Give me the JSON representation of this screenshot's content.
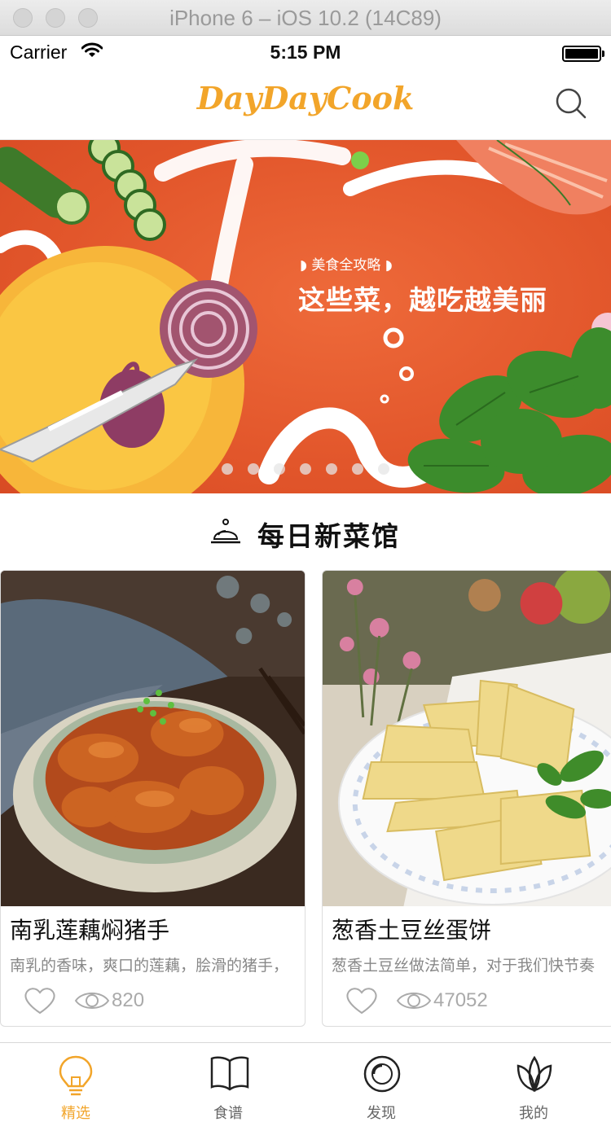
{
  "window": {
    "title": "iPhone 6 – iOS 10.2 (14C89)"
  },
  "status_bar": {
    "carrier": "Carrier",
    "time": "5:15 PM"
  },
  "navbar": {
    "logo": "DayDayCook",
    "search_icon": "search-icon"
  },
  "banner": {
    "tag": "美食全攻略",
    "title": "这些菜，越吃越美丽",
    "page_count": 7,
    "current_page": 3
  },
  "section": {
    "title": "每日新菜馆",
    "icon": "service-bell-icon"
  },
  "cards": [
    {
      "title": "南乳莲藕焖猪手",
      "description": "南乳的香味，爽口的莲藕，脍滑的猪手，",
      "views": "820"
    },
    {
      "title": "葱香土豆丝蛋饼",
      "description": "葱香土豆丝做法简单，对于我们快节奏",
      "views": "47052"
    }
  ],
  "tabbar": {
    "tabs": [
      {
        "label": "精选",
        "icon": "lightbulb-icon",
        "active": true
      },
      {
        "label": "食谱",
        "icon": "open-book-icon",
        "active": false
      },
      {
        "label": "发现",
        "icon": "compass-icon",
        "active": false
      },
      {
        "label": "我的",
        "icon": "lotus-icon",
        "active": false
      }
    ]
  },
  "colors": {
    "accent": "#f2a52a",
    "banner_bg": "#e2562b"
  }
}
